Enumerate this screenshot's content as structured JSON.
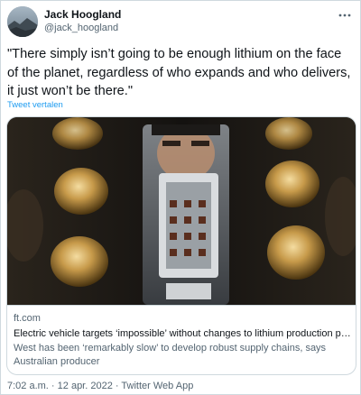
{
  "author": {
    "display_name": "Jack Hoogland",
    "handle": "@jack_hoogland",
    "avatar_icon": "avatar-photo"
  },
  "more_icon": "more-icon",
  "tweet": {
    "text": "\"There simply isn’t going to be enough lithium on the face of the planet, regardless of who expands and who delivers, it just won’t be there.\"",
    "translate_label": "Tweet vertalen"
  },
  "card": {
    "domain": "ft.com",
    "title": "Electric vehicle targets ‘impossible’ without changes to lithium production pipel...",
    "description": "West has been ‘remarkably slow’ to develop robust supply chains, says Australian producer"
  },
  "footer": {
    "time": "7:02 a.m.",
    "separator": "·",
    "date": "12 apr. 2022",
    "source": "Twitter Web App"
  },
  "colors": {
    "link": "#1d9bf0",
    "secondary_text": "#536471",
    "border": "#cfd9de"
  }
}
